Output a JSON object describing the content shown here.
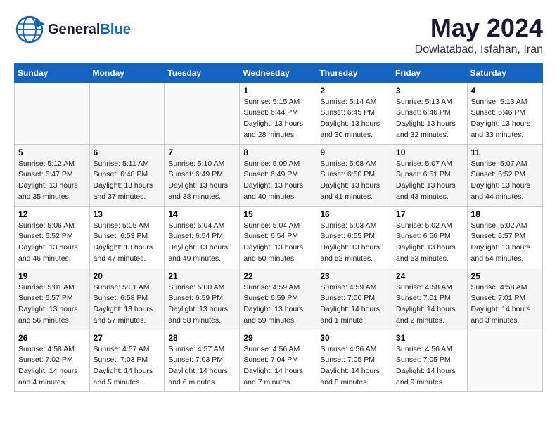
{
  "header": {
    "logo_line1": "General",
    "logo_line2": "Blue",
    "month": "May 2024",
    "location": "Dowlatabad, Isfahan, Iran"
  },
  "weekdays": [
    "Sunday",
    "Monday",
    "Tuesday",
    "Wednesday",
    "Thursday",
    "Friday",
    "Saturday"
  ],
  "weeks": [
    [
      {
        "day": "",
        "info": ""
      },
      {
        "day": "",
        "info": ""
      },
      {
        "day": "",
        "info": ""
      },
      {
        "day": "1",
        "info": "Sunrise: 5:15 AM\nSunset: 6:44 PM\nDaylight: 13 hours\nand 28 minutes."
      },
      {
        "day": "2",
        "info": "Sunrise: 5:14 AM\nSunset: 6:45 PM\nDaylight: 13 hours\nand 30 minutes."
      },
      {
        "day": "3",
        "info": "Sunrise: 5:13 AM\nSunset: 6:46 PM\nDaylight: 13 hours\nand 32 minutes."
      },
      {
        "day": "4",
        "info": "Sunrise: 5:13 AM\nSunset: 6:46 PM\nDaylight: 13 hours\nand 33 minutes."
      }
    ],
    [
      {
        "day": "5",
        "info": "Sunrise: 5:12 AM\nSunset: 6:47 PM\nDaylight: 13 hours\nand 35 minutes."
      },
      {
        "day": "6",
        "info": "Sunrise: 5:11 AM\nSunset: 6:48 PM\nDaylight: 13 hours\nand 37 minutes."
      },
      {
        "day": "7",
        "info": "Sunrise: 5:10 AM\nSunset: 6:49 PM\nDaylight: 13 hours\nand 38 minutes."
      },
      {
        "day": "8",
        "info": "Sunrise: 5:09 AM\nSunset: 6:49 PM\nDaylight: 13 hours\nand 40 minutes."
      },
      {
        "day": "9",
        "info": "Sunrise: 5:08 AM\nSunset: 6:50 PM\nDaylight: 13 hours\nand 41 minutes."
      },
      {
        "day": "10",
        "info": "Sunrise: 5:07 AM\nSunset: 6:51 PM\nDaylight: 13 hours\nand 43 minutes."
      },
      {
        "day": "11",
        "info": "Sunrise: 5:07 AM\nSunset: 6:52 PM\nDaylight: 13 hours\nand 44 minutes."
      }
    ],
    [
      {
        "day": "12",
        "info": "Sunrise: 5:06 AM\nSunset: 6:52 PM\nDaylight: 13 hours\nand 46 minutes."
      },
      {
        "day": "13",
        "info": "Sunrise: 5:05 AM\nSunset: 6:53 PM\nDaylight: 13 hours\nand 47 minutes."
      },
      {
        "day": "14",
        "info": "Sunrise: 5:04 AM\nSunset: 6:54 PM\nDaylight: 13 hours\nand 49 minutes."
      },
      {
        "day": "15",
        "info": "Sunrise: 5:04 AM\nSunset: 6:54 PM\nDaylight: 13 hours\nand 50 minutes."
      },
      {
        "day": "16",
        "info": "Sunrise: 5:03 AM\nSunset: 6:55 PM\nDaylight: 13 hours\nand 52 minutes."
      },
      {
        "day": "17",
        "info": "Sunrise: 5:02 AM\nSunset: 6:56 PM\nDaylight: 13 hours\nand 53 minutes."
      },
      {
        "day": "18",
        "info": "Sunrise: 5:02 AM\nSunset: 6:57 PM\nDaylight: 13 hours\nand 54 minutes."
      }
    ],
    [
      {
        "day": "19",
        "info": "Sunrise: 5:01 AM\nSunset: 6:57 PM\nDaylight: 13 hours\nand 56 minutes."
      },
      {
        "day": "20",
        "info": "Sunrise: 5:01 AM\nSunset: 6:58 PM\nDaylight: 13 hours\nand 57 minutes."
      },
      {
        "day": "21",
        "info": "Sunrise: 5:00 AM\nSunset: 6:59 PM\nDaylight: 13 hours\nand 58 minutes."
      },
      {
        "day": "22",
        "info": "Sunrise: 4:59 AM\nSunset: 6:59 PM\nDaylight: 13 hours\nand 59 minutes."
      },
      {
        "day": "23",
        "info": "Sunrise: 4:59 AM\nSunset: 7:00 PM\nDaylight: 14 hours\nand 1 minute."
      },
      {
        "day": "24",
        "info": "Sunrise: 4:58 AM\nSunset: 7:01 PM\nDaylight: 14 hours\nand 2 minutes."
      },
      {
        "day": "25",
        "info": "Sunrise: 4:58 AM\nSunset: 7:01 PM\nDaylight: 14 hours\nand 3 minutes."
      }
    ],
    [
      {
        "day": "26",
        "info": "Sunrise: 4:58 AM\nSunset: 7:02 PM\nDaylight: 14 hours\nand 4 minutes."
      },
      {
        "day": "27",
        "info": "Sunrise: 4:57 AM\nSunset: 7:03 PM\nDaylight: 14 hours\nand 5 minutes."
      },
      {
        "day": "28",
        "info": "Sunrise: 4:57 AM\nSunset: 7:03 PM\nDaylight: 14 hours\nand 6 minutes."
      },
      {
        "day": "29",
        "info": "Sunrise: 4:56 AM\nSunset: 7:04 PM\nDaylight: 14 hours\nand 7 minutes."
      },
      {
        "day": "30",
        "info": "Sunrise: 4:56 AM\nSunset: 7:05 PM\nDaylight: 14 hours\nand 8 minutes."
      },
      {
        "day": "31",
        "info": "Sunrise: 4:56 AM\nSunset: 7:05 PM\nDaylight: 14 hours\nand 9 minutes."
      },
      {
        "day": "",
        "info": ""
      }
    ]
  ]
}
